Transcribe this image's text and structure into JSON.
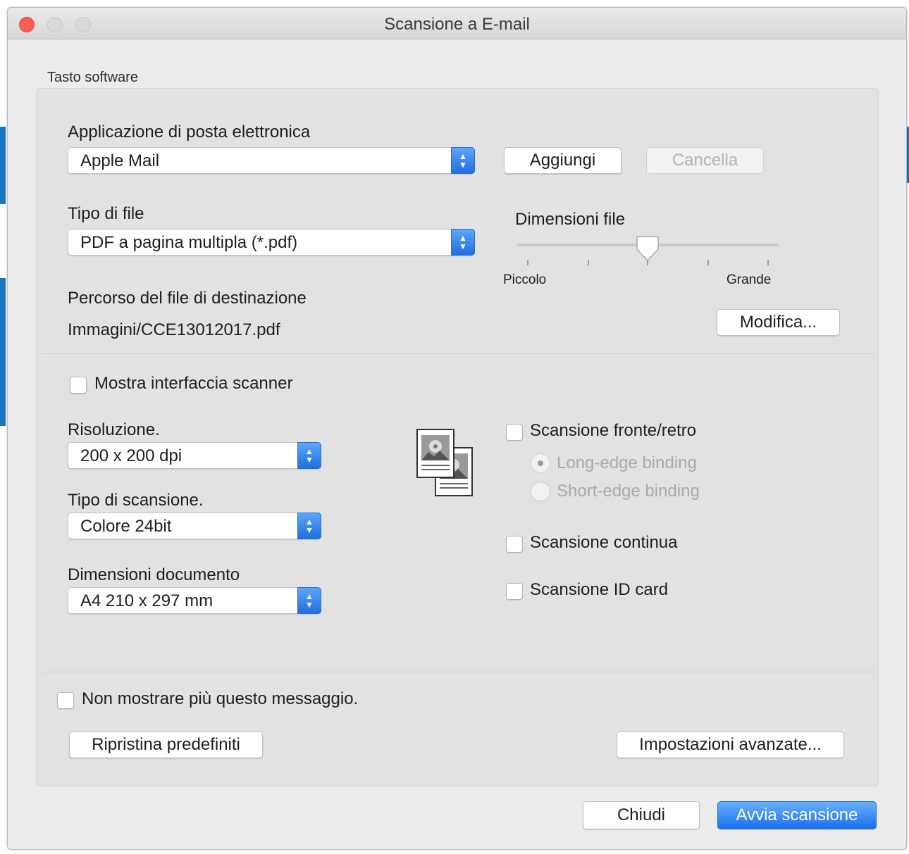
{
  "window": {
    "title": "Scansione a E-mail"
  },
  "group_label": "Tasto software",
  "email_app": {
    "label": "Applicazione di posta elettronica",
    "value": "Apple Mail",
    "add_label": "Aggiungi",
    "delete_label": "Cancella"
  },
  "file_type": {
    "label": "Tipo di file",
    "value": "PDF a pagina multipla (*.pdf)"
  },
  "file_size": {
    "label": "Dimensioni file",
    "min_label": "Piccolo",
    "max_label": "Grande",
    "level": 0.5,
    "ticks": 5
  },
  "destination": {
    "label": "Percorso del file di destinazione",
    "value": "Immagini/CCE13012017.pdf",
    "modify_label": "Modifica..."
  },
  "show_scanner_ui": {
    "label": "Mostra interfaccia scanner",
    "checked": false
  },
  "resolution": {
    "label": "Risoluzione.",
    "value": "200 x 200 dpi"
  },
  "scan_type": {
    "label": "Tipo di scansione.",
    "value": "Colore 24bit"
  },
  "doc_size": {
    "label": "Dimensioni documento",
    "value": "A4 210 x 297 mm"
  },
  "duplex": {
    "label": "Scansione fronte/retro",
    "checked": false,
    "long_edge": "Long-edge binding",
    "short_edge": "Short-edge binding",
    "selected": "long"
  },
  "continuous": {
    "label": "Scansione continua",
    "checked": false
  },
  "id_card": {
    "label": "Scansione ID card",
    "checked": false
  },
  "dont_show": {
    "label": "Non mostrare più questo messaggio.",
    "checked": false
  },
  "buttons": {
    "restore": "Ripristina predefiniti",
    "advanced": "Impostazioni avanzate...",
    "close": "Chiudi",
    "start": "Avvia scansione"
  },
  "icons": {
    "scan_preview": "document-pages-icon",
    "stepper": "chevron-updown-icon"
  },
  "colors": {
    "accent": "#1a6ff0",
    "close_light": "#fc5d57"
  }
}
